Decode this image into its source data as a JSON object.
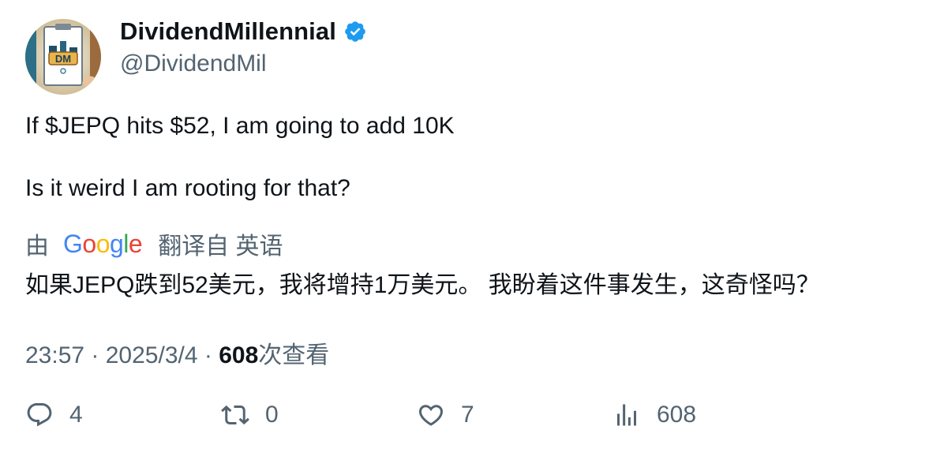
{
  "author": {
    "display_name": "DividendMillennial",
    "handle": "@DividendMil",
    "verified": true,
    "avatar_text": "DM",
    "verified_color": "#1D9BF0"
  },
  "tweet": {
    "line1": "If $JEPQ hits $52, I am going to add 10K",
    "line2": "Is it weird I am rooting for that?"
  },
  "translation": {
    "by_label": "由",
    "provider": "Google",
    "from_label": "翻译自 英语",
    "text": "如果JEPQ跌到52美元，我将增持1万美元。 我盼着这件事发生，这奇怪吗？"
  },
  "meta": {
    "time": "23:57",
    "separator": "·",
    "date": "2025/3/4",
    "views_count": "608",
    "views_label": "次查看"
  },
  "actions": {
    "replies": "4",
    "retweets": "0",
    "likes": "7",
    "views": "608"
  },
  "icons": {
    "reply": "reply-icon",
    "retweet": "retweet-icon",
    "like": "heart-icon",
    "views": "analytics-icon",
    "verified": "verified-badge-icon"
  }
}
